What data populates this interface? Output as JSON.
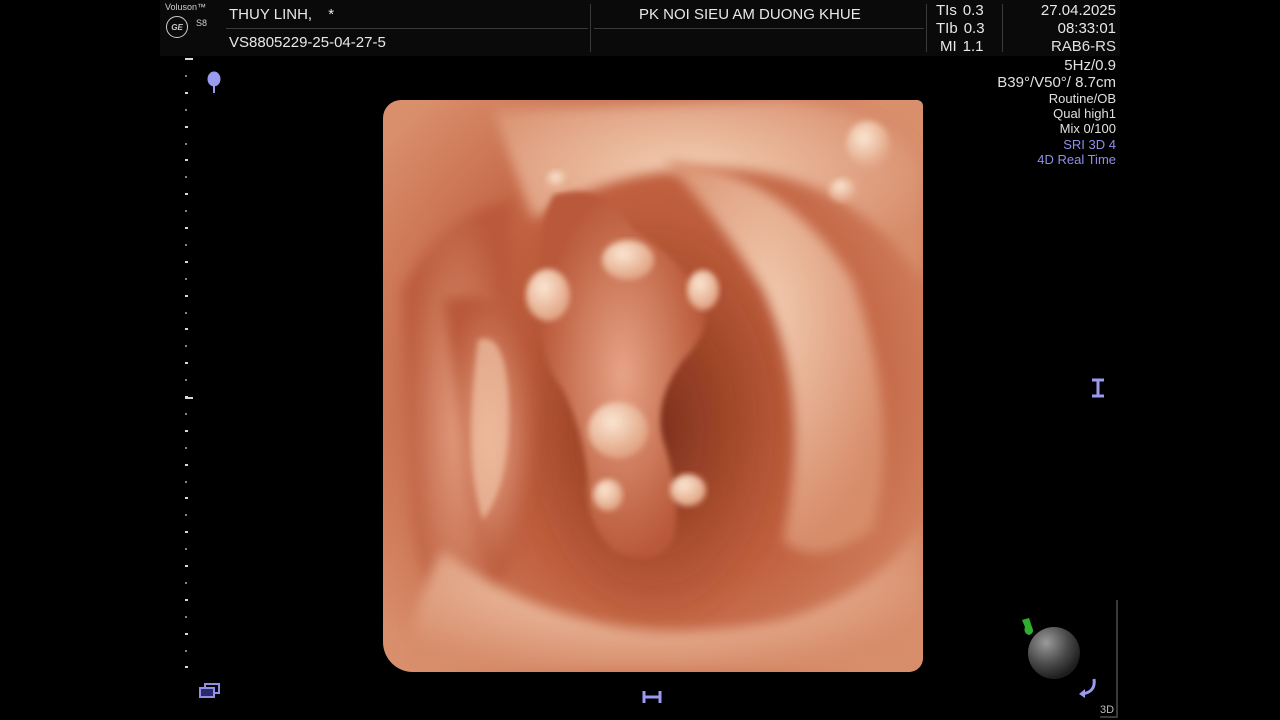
{
  "brand": {
    "name": "Voluson™",
    "model": "S8",
    "logo_text": "GE"
  },
  "header": {
    "patient_name": "THUY LINH,",
    "patient_flag": "*",
    "patient_id": "VS8805229-25-04-27-5",
    "clinic": "PK NOI SIEU AM DUONG KHUE"
  },
  "params": [
    {
      "label": "TIs",
      "value": "0.3"
    },
    {
      "label": "TIb",
      "value": "0.3"
    },
    {
      "label": "MI",
      "value": "1.1"
    }
  ],
  "datetime": {
    "date": "27.04.2025",
    "time": "08:33:01"
  },
  "probe_info": {
    "probe": "RAB6-RS",
    "frequency": "5Hz/0.9",
    "volume_angles": "B39°/V50°/ 8.7cm",
    "preset": "Routine/OB",
    "quality": "Qual high1",
    "mix": "Mix 0/100",
    "sri": "SRI 3D 4",
    "mode": "4D Real Time"
  },
  "view_label": "3D",
  "colors": {
    "accent": "#8f8fe6",
    "tissue": "#c8714f",
    "green_marker": "#2fae2f"
  },
  "icons": {
    "focus_marker": "focus-pin-icon",
    "layout": "layout-window-icon",
    "bottom_bracket": "bracket-horizontal-icon",
    "right_bracket": "bracket-vertical-icon",
    "rotation_ball": "rotation-sphere-icon",
    "light_source": "light-source-icon",
    "curve_tool": "curve-arrow-icon"
  }
}
